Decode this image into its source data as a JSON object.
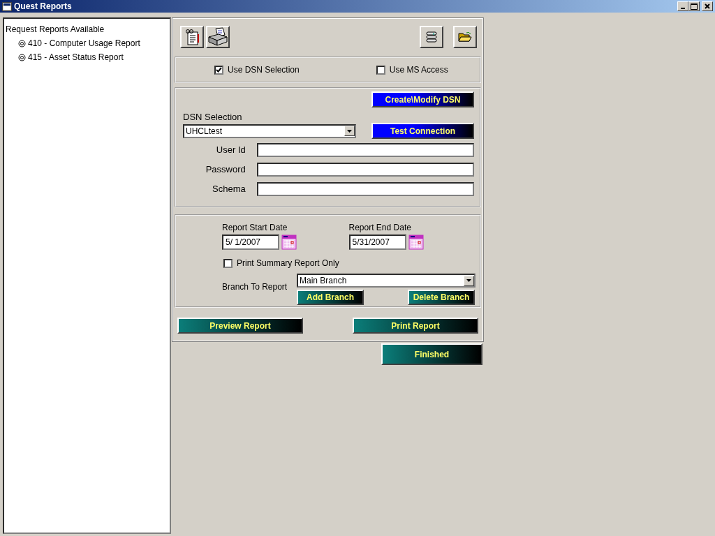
{
  "window": {
    "title": "Quest Reports"
  },
  "report_tree": {
    "heading": "Request Reports Available",
    "items": [
      {
        "label": "410 - Computer Usage Report"
      },
      {
        "label": "415 - Asset Status Report"
      }
    ]
  },
  "source_options": [
    {
      "label": "Use DSN Selection",
      "checked": true
    },
    {
      "label": "Use MS Access",
      "checked": false
    }
  ],
  "dsn": {
    "create_button": "Create\\Modify DSN",
    "label": "DSN Selection",
    "value": "UHCLtest",
    "test_button": "Test Connection",
    "fields": [
      {
        "label": "User Id"
      },
      {
        "label": "Password"
      },
      {
        "label": "Schema"
      }
    ]
  },
  "dates": [
    {
      "label": "Report Start Date",
      "value": "5/ 1/2007"
    },
    {
      "label": "Report End Date",
      "value": "5/31/2007"
    }
  ],
  "summary_only": {
    "label": "Print Summary Report Only",
    "checked": false
  },
  "branch": {
    "label": "Branch To Report",
    "value": "Main Branch",
    "add_button": "Add Branch",
    "delete_button": "Delete Branch"
  },
  "actions": [
    "Preview Report",
    "Print Report"
  ],
  "finish_button": "Finished"
}
